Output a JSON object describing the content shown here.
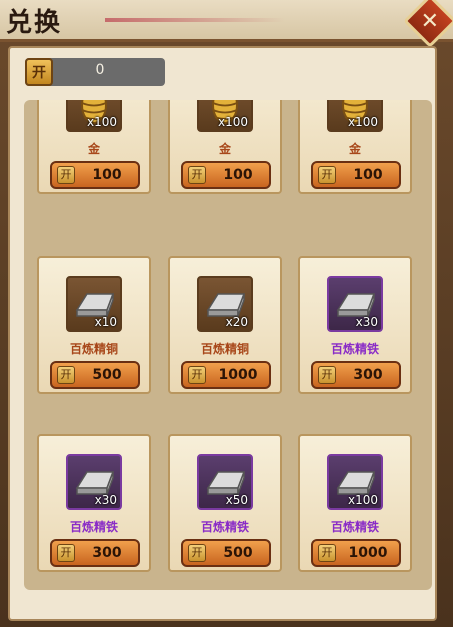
{
  "window": {
    "title": "兑换",
    "close_icon": "close-icon"
  },
  "currency": {
    "icon": "coin-icon",
    "icon_glyph": "开",
    "balance": "0"
  },
  "colors": {
    "name_normal": "#a8471a",
    "name_rare": "#8a2cc7"
  },
  "items": [
    {
      "name": "金",
      "qty": "x100",
      "price": "100",
      "icon": "gold-cocoon-icon",
      "rarity": "normal"
    },
    {
      "name": "金",
      "qty": "x100",
      "price": "100",
      "icon": "gold-cocoon-icon",
      "rarity": "normal"
    },
    {
      "name": "金",
      "qty": "x100",
      "price": "100",
      "icon": "gold-cocoon-icon",
      "rarity": "normal"
    },
    {
      "name": "百炼精铜",
      "qty": "x10",
      "price": "500",
      "icon": "ingot-icon",
      "rarity": "normal"
    },
    {
      "name": "百炼精铜",
      "qty": "x20",
      "price": "1000",
      "icon": "ingot-icon",
      "rarity": "normal"
    },
    {
      "name": "百炼精铁",
      "qty": "x30",
      "price": "300",
      "icon": "ingot-icon",
      "rarity": "rare"
    },
    {
      "name": "百炼精铁",
      "qty": "x30",
      "price": "300",
      "icon": "ingot-icon",
      "rarity": "rare"
    },
    {
      "name": "百炼精铁",
      "qty": "x50",
      "price": "500",
      "icon": "ingot-icon",
      "rarity": "rare"
    },
    {
      "name": "百炼精铁",
      "qty": "x100",
      "price": "1000",
      "icon": "ingot-icon",
      "rarity": "rare"
    }
  ]
}
